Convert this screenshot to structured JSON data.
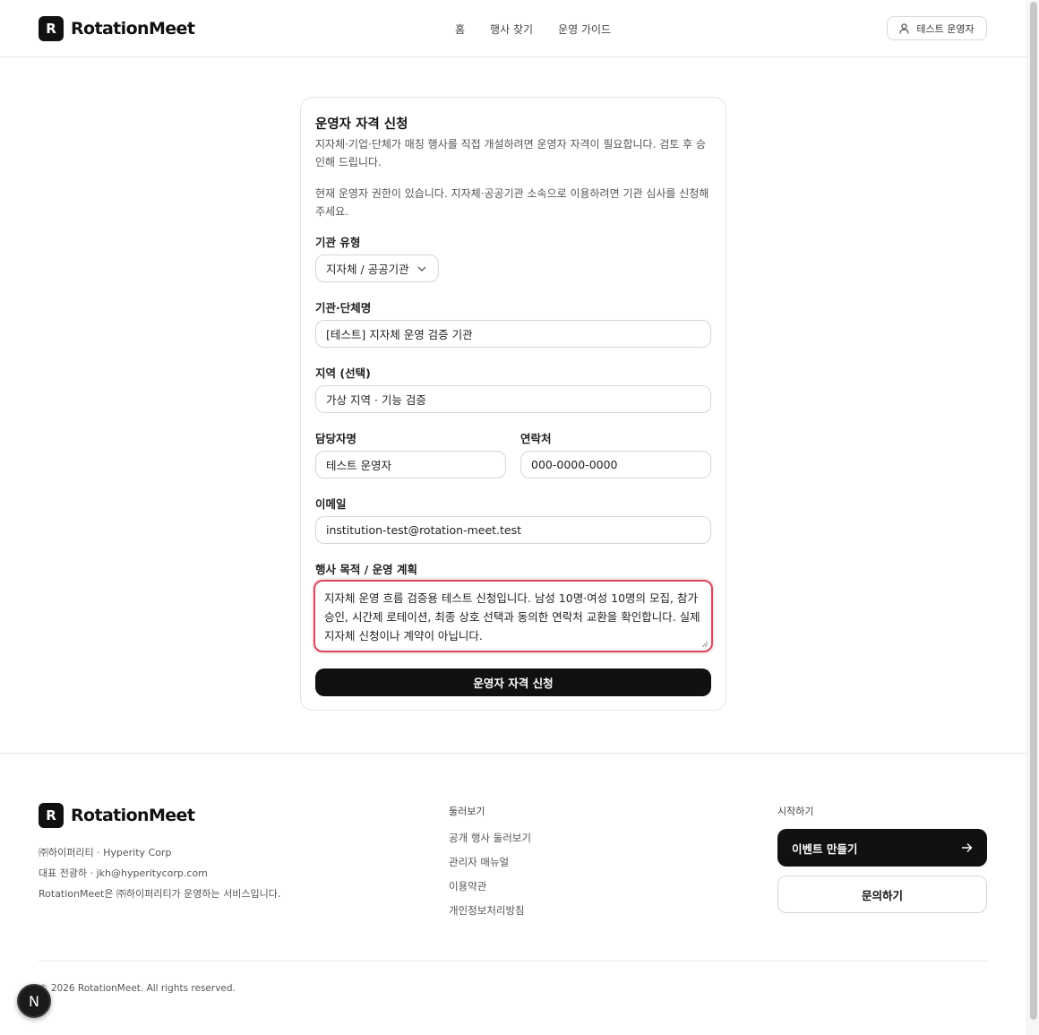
{
  "header": {
    "brand_mark": "R",
    "brand_name": "RotationMeet",
    "nav": [
      "홈",
      "행사 찾기",
      "운영 가이드"
    ],
    "user_label": "테스트 운영자"
  },
  "form": {
    "title": "운영자 자격 신청",
    "description": "지자체·기업·단체가 매칭 행사를 직접 개설하려면 운영자 자격이 필요합니다. 검토 후 승인해 드립니다.",
    "note": "현재 운영자 권한이 있습니다. 지자체·공공기관 소속으로 이용하려면 기관 심사를 신청해주세요.",
    "org_type_label": "기관 유형",
    "org_type_value": "지자체 / 공공기관",
    "org_name_label": "기관·단체명",
    "org_name_value": "[테스트] 지자체 운영 검증 기관",
    "region_label": "지역 (선택)",
    "region_value": "가상 지역 · 기능 검증",
    "manager_label": "담당자명",
    "manager_value": "테스트 운영자",
    "phone_label": "연락처",
    "phone_value": "000-0000-0000",
    "email_label": "이메일",
    "email_value": "institution-test@rotation-meet.test",
    "plan_label": "행사 목적 / 운영 계획",
    "plan_value": "지자체 운영 흐름 검증용 테스트 신청입니다. 남성 10명·여성 10명의 모집, 참가 승인, 시간제 로테이션, 최종 상호 선택과 동의한 연락처 교환을 확인합니다. 실제 지자체 신청이나 계약이 아닙니다.",
    "submit_label": "운영자 자격 신청"
  },
  "footer": {
    "brand_mark": "R",
    "brand_name": "RotationMeet",
    "company": "㈜하이퍼리티 · Hyperity Corp",
    "representative": "대표 전광하 · jkh@hyperitycorp.com",
    "service_note": "RotationMeet은 ㈜하이퍼리티가 운영하는 서비스입니다.",
    "browse_title": "둘러보기",
    "browse_links": [
      "공개 행사 둘러보기",
      "관리자 매뉴얼",
      "이용약관",
      "개인정보처리방침"
    ],
    "start_title": "시작하기",
    "create_label": "이벤트 만들기",
    "contact_label": "문의하기",
    "copyright": "© 2026 RotationMeet. All rights reserved.",
    "badge": "N"
  },
  "colors": {
    "primary": "#111111",
    "textarea_focus_border": "#d9475c",
    "border": "#d6d6d6"
  },
  "icons": {
    "user": "user-icon",
    "chevron": "chevron-down-icon",
    "arrow": "arrow-right-icon"
  }
}
